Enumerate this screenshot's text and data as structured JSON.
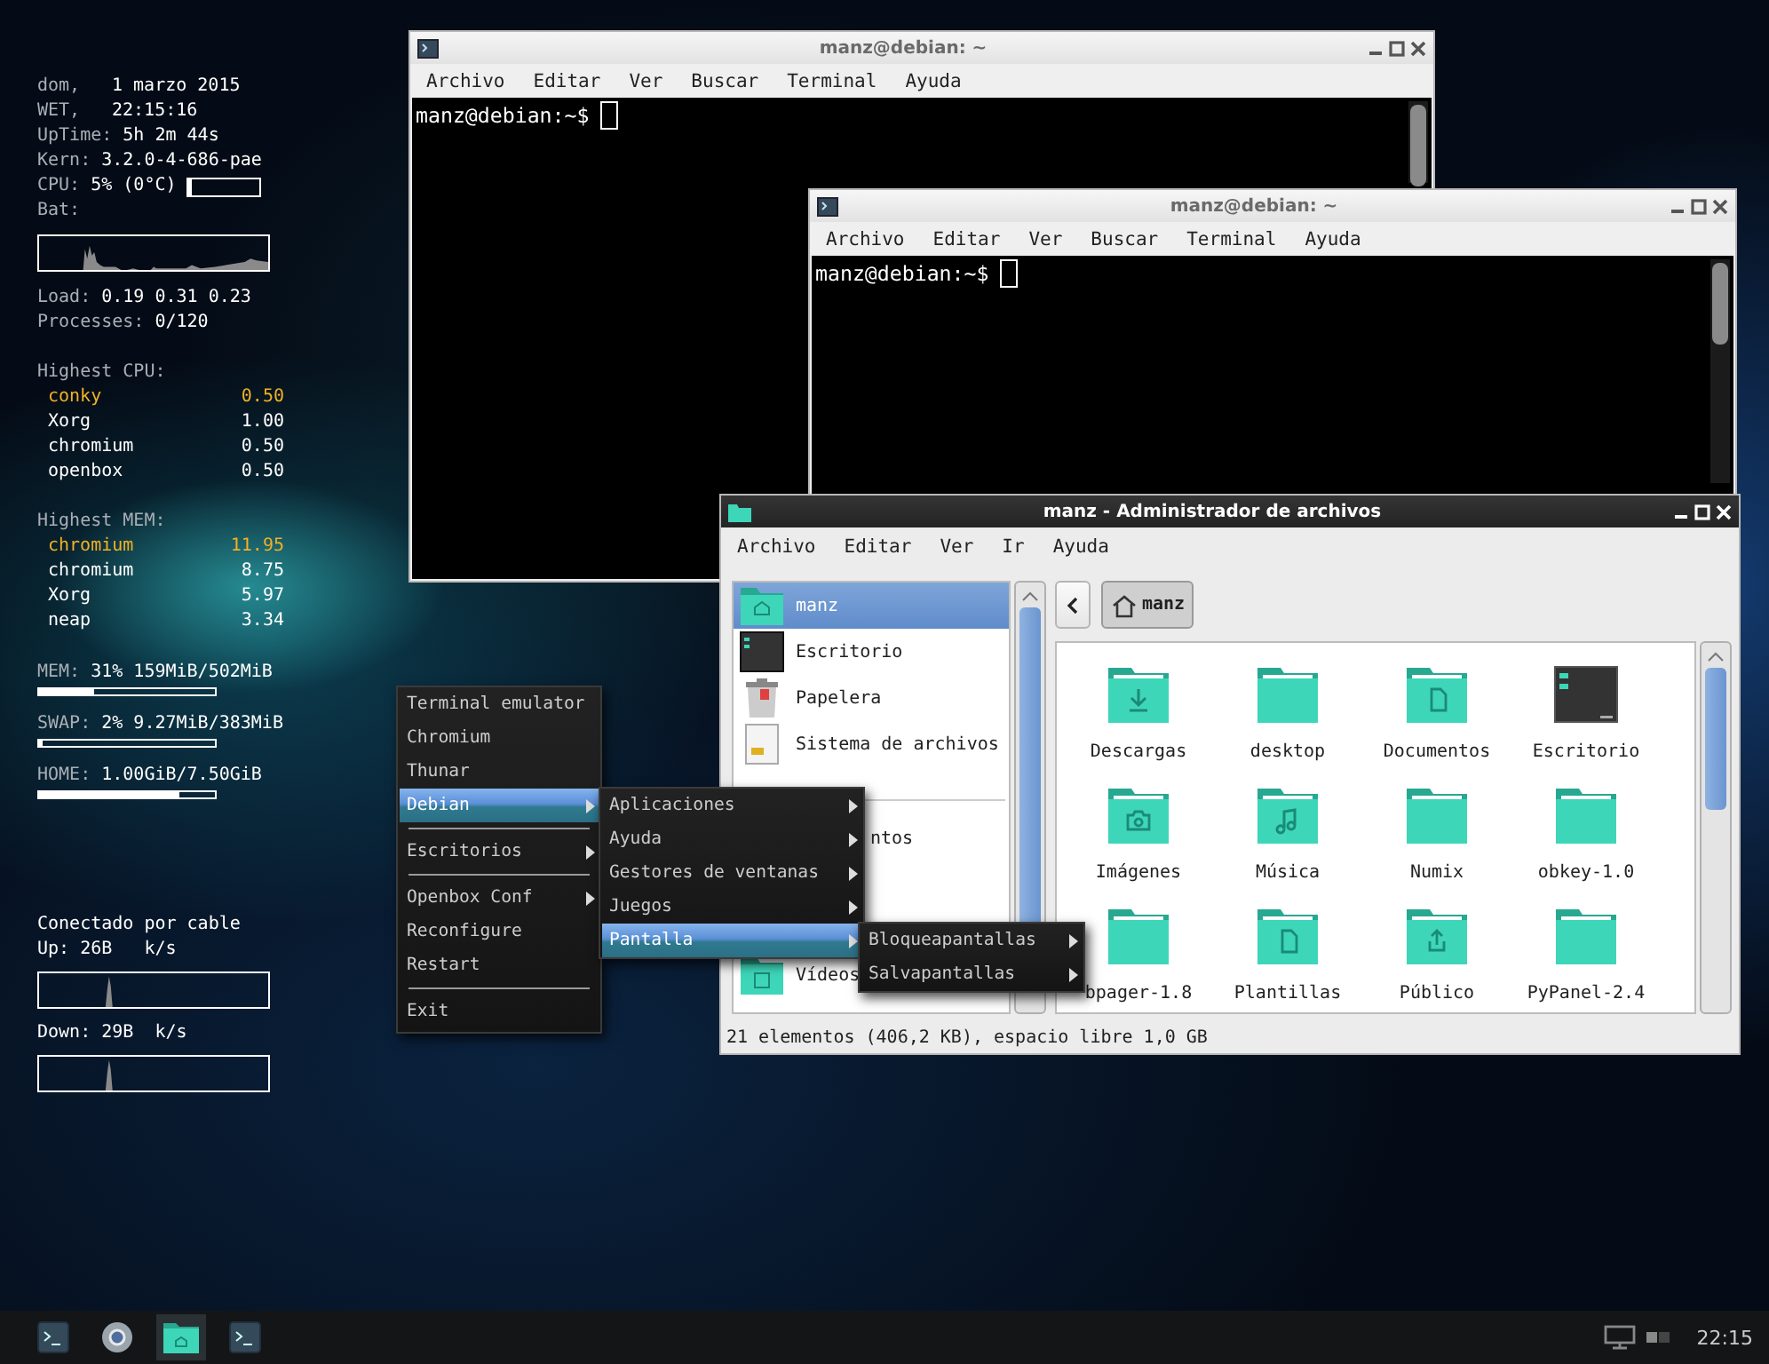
{
  "conky": {
    "info": [
      {
        "label": "dom,",
        "value": "1 marzo 2015"
      },
      {
        "label": "WET,",
        "value": "22:15:16"
      },
      {
        "label": "UpTime:",
        "value": "5h 2m 44s"
      },
      {
        "label": "Kern:",
        "value": "3.2.0-4-686-pae"
      }
    ],
    "cpu": {
      "label": "CPU:",
      "value": "5% (0°C)",
      "level": 0.05
    },
    "bat": {
      "label": "Bat:"
    },
    "load": {
      "label": "Load:",
      "value": "0.19 0.31 0.23"
    },
    "processes": {
      "label": "Processes:",
      "value": "0/120"
    },
    "top_lists": [
      {
        "title": "Highest CPU:",
        "rows": [
          {
            "name": "conky",
            "value": "0.50",
            "highlight": true
          },
          {
            "name": "Xorg",
            "value": "1.00",
            "highlight": false
          },
          {
            "name": "chromium",
            "value": "0.50",
            "highlight": false
          },
          {
            "name": "openbox",
            "value": "0.50",
            "highlight": false
          }
        ]
      },
      {
        "title": "Highest MEM:",
        "rows": [
          {
            "name": "chromium",
            "value": "11.95",
            "highlight": true
          },
          {
            "name": "chromium",
            "value": "8.75",
            "highlight": false
          },
          {
            "name": "Xorg",
            "value": "5.97",
            "highlight": false
          },
          {
            "name": "neap",
            "value": "3.34",
            "highlight": false
          }
        ]
      }
    ],
    "meters": [
      {
        "label": "MEM:",
        "value": "31% 159MiB/502MiB",
        "level": 0.31
      },
      {
        "label": "SWAP:",
        "value": "2% 9.27MiB/383MiB",
        "level": 0.02
      },
      {
        "label": "HOME:",
        "value": "1.00GiB/7.50GiB",
        "level": 0.8
      }
    ],
    "network": {
      "status": "Conectado por cable",
      "up": "Up: 26B   k/s",
      "down": "Down: 29B  k/s"
    }
  },
  "terminal_windows": [
    {
      "title": "manz@debian: ~",
      "active": false,
      "menu": [
        "Archivo",
        "Editar",
        "Ver",
        "Buscar",
        "Terminal",
        "Ayuda"
      ],
      "prompt": "manz@debian:~$"
    },
    {
      "title": "manz@debian: ~",
      "active": false,
      "menu": [
        "Archivo",
        "Editar",
        "Ver",
        "Buscar",
        "Terminal",
        "Ayuda"
      ],
      "prompt": "manz@debian:~$"
    }
  ],
  "file_manager": {
    "title": "manz - Administrador de archivos",
    "active": true,
    "menu": [
      "Archivo",
      "Editar",
      "Ver",
      "Ir",
      "Ayuda"
    ],
    "sidebar": {
      "places": [
        {
          "label": "manz",
          "kind": "home",
          "selected": true
        },
        {
          "label": "Escritorio",
          "kind": "screen",
          "selected": false
        },
        {
          "label": "Papelera",
          "kind": "trash",
          "selected": false
        },
        {
          "label": "Sistema de archivos",
          "kind": "drive",
          "selected": false
        }
      ],
      "bookmarks": [
        {
          "label": "ntos",
          "kind": "covered",
          "selected": false
        },
        {
          "label": "Vídeos",
          "kind": "video",
          "selected": false
        }
      ]
    },
    "path": {
      "crumb": "manz"
    },
    "items": [
      {
        "label": "Descargas",
        "kind": "download"
      },
      {
        "label": "desktop",
        "kind": "folder"
      },
      {
        "label": "Documentos",
        "kind": "document"
      },
      {
        "label": "Escritorio",
        "kind": "screen"
      },
      {
        "label": "Imágenes",
        "kind": "camera"
      },
      {
        "label": "Música",
        "kind": "music"
      },
      {
        "label": "Numix",
        "kind": "folder"
      },
      {
        "label": "obkey-1.0",
        "kind": "folder"
      },
      {
        "label": "bpager-1.8",
        "kind": "folder"
      },
      {
        "label": "Plantillas",
        "kind": "template"
      },
      {
        "label": "Público",
        "kind": "share"
      },
      {
        "label": "PyPanel-2.4",
        "kind": "folder"
      }
    ],
    "status": "21 elementos (406,2 KB), espacio libre 1,0 GB"
  },
  "menus": [
    {
      "items": [
        {
          "kind": "item",
          "label": "Terminal emulator",
          "submenu": false,
          "selected": false
        },
        {
          "kind": "item",
          "label": "Chromium",
          "submenu": false,
          "selected": false
        },
        {
          "kind": "item",
          "label": "Thunar",
          "submenu": false,
          "selected": false
        },
        {
          "kind": "item",
          "label": "Debian",
          "submenu": true,
          "selected": true
        },
        {
          "kind": "separator"
        },
        {
          "kind": "item",
          "label": "Escritorios",
          "submenu": true,
          "selected": false
        },
        {
          "kind": "separator"
        },
        {
          "kind": "item",
          "label": "Openbox Conf",
          "submenu": true,
          "selected": false
        },
        {
          "kind": "item",
          "label": "Reconfigure",
          "submenu": false,
          "selected": false
        },
        {
          "kind": "item",
          "label": "Restart",
          "submenu": false,
          "selected": false
        },
        {
          "kind": "separator"
        },
        {
          "kind": "item",
          "label": "Exit",
          "submenu": false,
          "selected": false
        }
      ]
    },
    {
      "items": [
        {
          "kind": "item",
          "label": "Aplicaciones",
          "submenu": true,
          "selected": false
        },
        {
          "kind": "item",
          "label": "Ayuda",
          "submenu": true,
          "selected": false
        },
        {
          "kind": "item",
          "label": "Gestores de ventanas",
          "submenu": true,
          "selected": false
        },
        {
          "kind": "item",
          "label": "Juegos",
          "submenu": true,
          "selected": false
        },
        {
          "kind": "item",
          "label": "Pantalla",
          "submenu": true,
          "selected": true
        }
      ]
    },
    {
      "items": [
        {
          "kind": "item",
          "label": "Bloqueapantallas",
          "submenu": true,
          "selected": false
        },
        {
          "kind": "item",
          "label": "Salvapantallas",
          "submenu": true,
          "selected": false
        }
      ]
    }
  ],
  "taskbar": {
    "apps": [
      {
        "kind": "terminal",
        "selected": false
      },
      {
        "kind": "browser",
        "selected": false
      },
      {
        "kind": "files",
        "selected": true
      },
      {
        "kind": "terminal",
        "selected": false
      }
    ],
    "clock": "22:15"
  }
}
